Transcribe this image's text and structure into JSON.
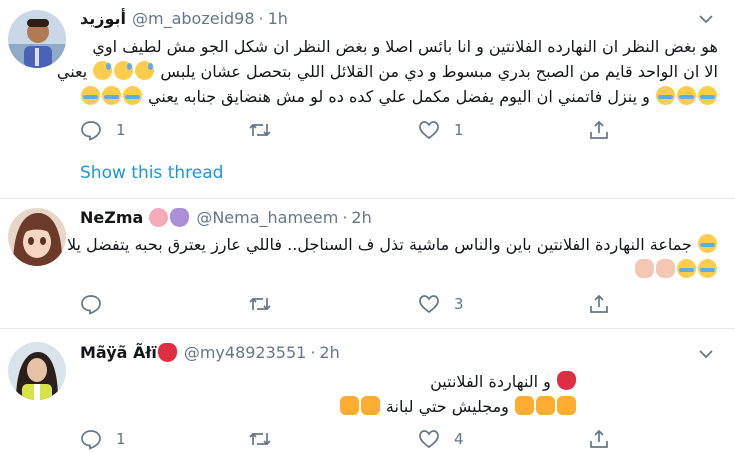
{
  "tweets": [
    {
      "display_name": "أبوزيد",
      "handle": "@m_abozeid98",
      "separator": "·",
      "time": "1h",
      "lines": [
        "هو بغض النظر ان النهارده الفلانتين و انا بائس اصلا و بغض النظر ان شكل الجو مش لطيف اوي",
        "يعني",
        "الا ان الواحد قايم من الصبح بدري مبسوط و دي من القلائل اللي بتحصل عشان يلبس",
        "و ينزل فاتمني ان اليوم يفضل مكمل علي كده ده لو مش هنضايق جنابه يعني"
      ],
      "replies": "1",
      "retweets": "",
      "likes": "1",
      "show_thread": "Show this thread"
    },
    {
      "display_name": "NeZma",
      "handle": "@Nema_hameem",
      "separator": "·",
      "time": "2h",
      "lines": [
        "جماعة النهاردة الفلانتين باين والناس ماشية تذل ف السناجل.. فاللي عارز يعترق بحبه يتفضل يلا"
      ],
      "replies": "",
      "retweets": "",
      "likes": "3"
    },
    {
      "display_name": "Mãÿã Ãłï",
      "handle": "@my48923551",
      "separator": "·",
      "time": "2h",
      "lines": [
        "و النهاردة الفلانتين",
        "ومجليش حتي لبانة"
      ],
      "replies": "1",
      "retweets": "",
      "likes": "4"
    }
  ],
  "icons": {
    "reply": "reply-icon",
    "retweet": "retweet-icon",
    "like": "heart-icon",
    "share": "share-icon",
    "caret": "chevron-down-icon"
  },
  "colors": {
    "link": "#1b95e0",
    "secondary_text": "#657786",
    "divider": "#e6ecf0"
  }
}
